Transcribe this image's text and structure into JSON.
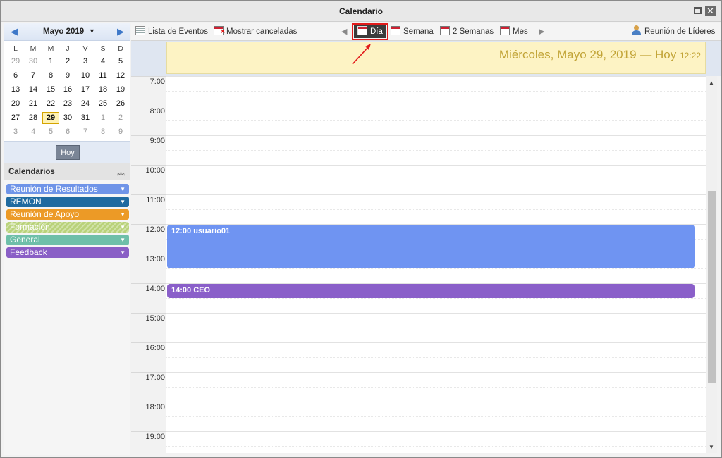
{
  "window": {
    "title": "Calendario"
  },
  "mini_calendar": {
    "month_label": "Mayo 2019",
    "weekdays": [
      "L",
      "M",
      "M",
      "J",
      "V",
      "S",
      "D"
    ],
    "weeks": [
      [
        "29",
        "30",
        "1",
        "2",
        "3",
        "4",
        "5"
      ],
      [
        "6",
        "7",
        "8",
        "9",
        "10",
        "11",
        "12"
      ],
      [
        "13",
        "14",
        "15",
        "16",
        "17",
        "18",
        "19"
      ],
      [
        "20",
        "21",
        "22",
        "23",
        "24",
        "25",
        "26"
      ],
      [
        "27",
        "28",
        "29",
        "30",
        "31",
        "1",
        "2"
      ],
      [
        "3",
        "4",
        "5",
        "6",
        "7",
        "8",
        "9"
      ]
    ],
    "today_button": "Hoy"
  },
  "calendars": {
    "header": "Calendarios",
    "items": [
      {
        "label": "Reunión de Resultados",
        "color": "#6f94e8"
      },
      {
        "label": "REMON",
        "color": "#1f6aa0"
      },
      {
        "label": "Reunión de Apoyo",
        "color": "#ec9a26"
      },
      {
        "label": "Formación",
        "color": "#b9d27a"
      },
      {
        "label": "General",
        "color": "#6ebfa9"
      },
      {
        "label": "Feedback",
        "color": "#8a5fc6"
      }
    ]
  },
  "toolbar": {
    "list_events": "Lista de Eventos",
    "show_cancelled": "Mostrar canceladas",
    "day": "Día",
    "week": "Semana",
    "two_weeks": "2 Semanas",
    "month": "Mes",
    "leaders_meeting": "Reunión de Líderes"
  },
  "day_header": {
    "date": "Miércoles, Mayo 29, 2019 — Hoy",
    "time": "12:22"
  },
  "hours": [
    "7:00",
    "8:00",
    "9:00",
    "10:00",
    "11:00",
    "12:00",
    "13:00",
    "14:00",
    "15:00",
    "16:00",
    "17:00",
    "18:00",
    "19:00"
  ],
  "events": [
    {
      "label": "12:00 usuario01",
      "color": "#6f94f2"
    },
    {
      "label": "14:00 CEO",
      "color": "#8a5fc9"
    }
  ]
}
